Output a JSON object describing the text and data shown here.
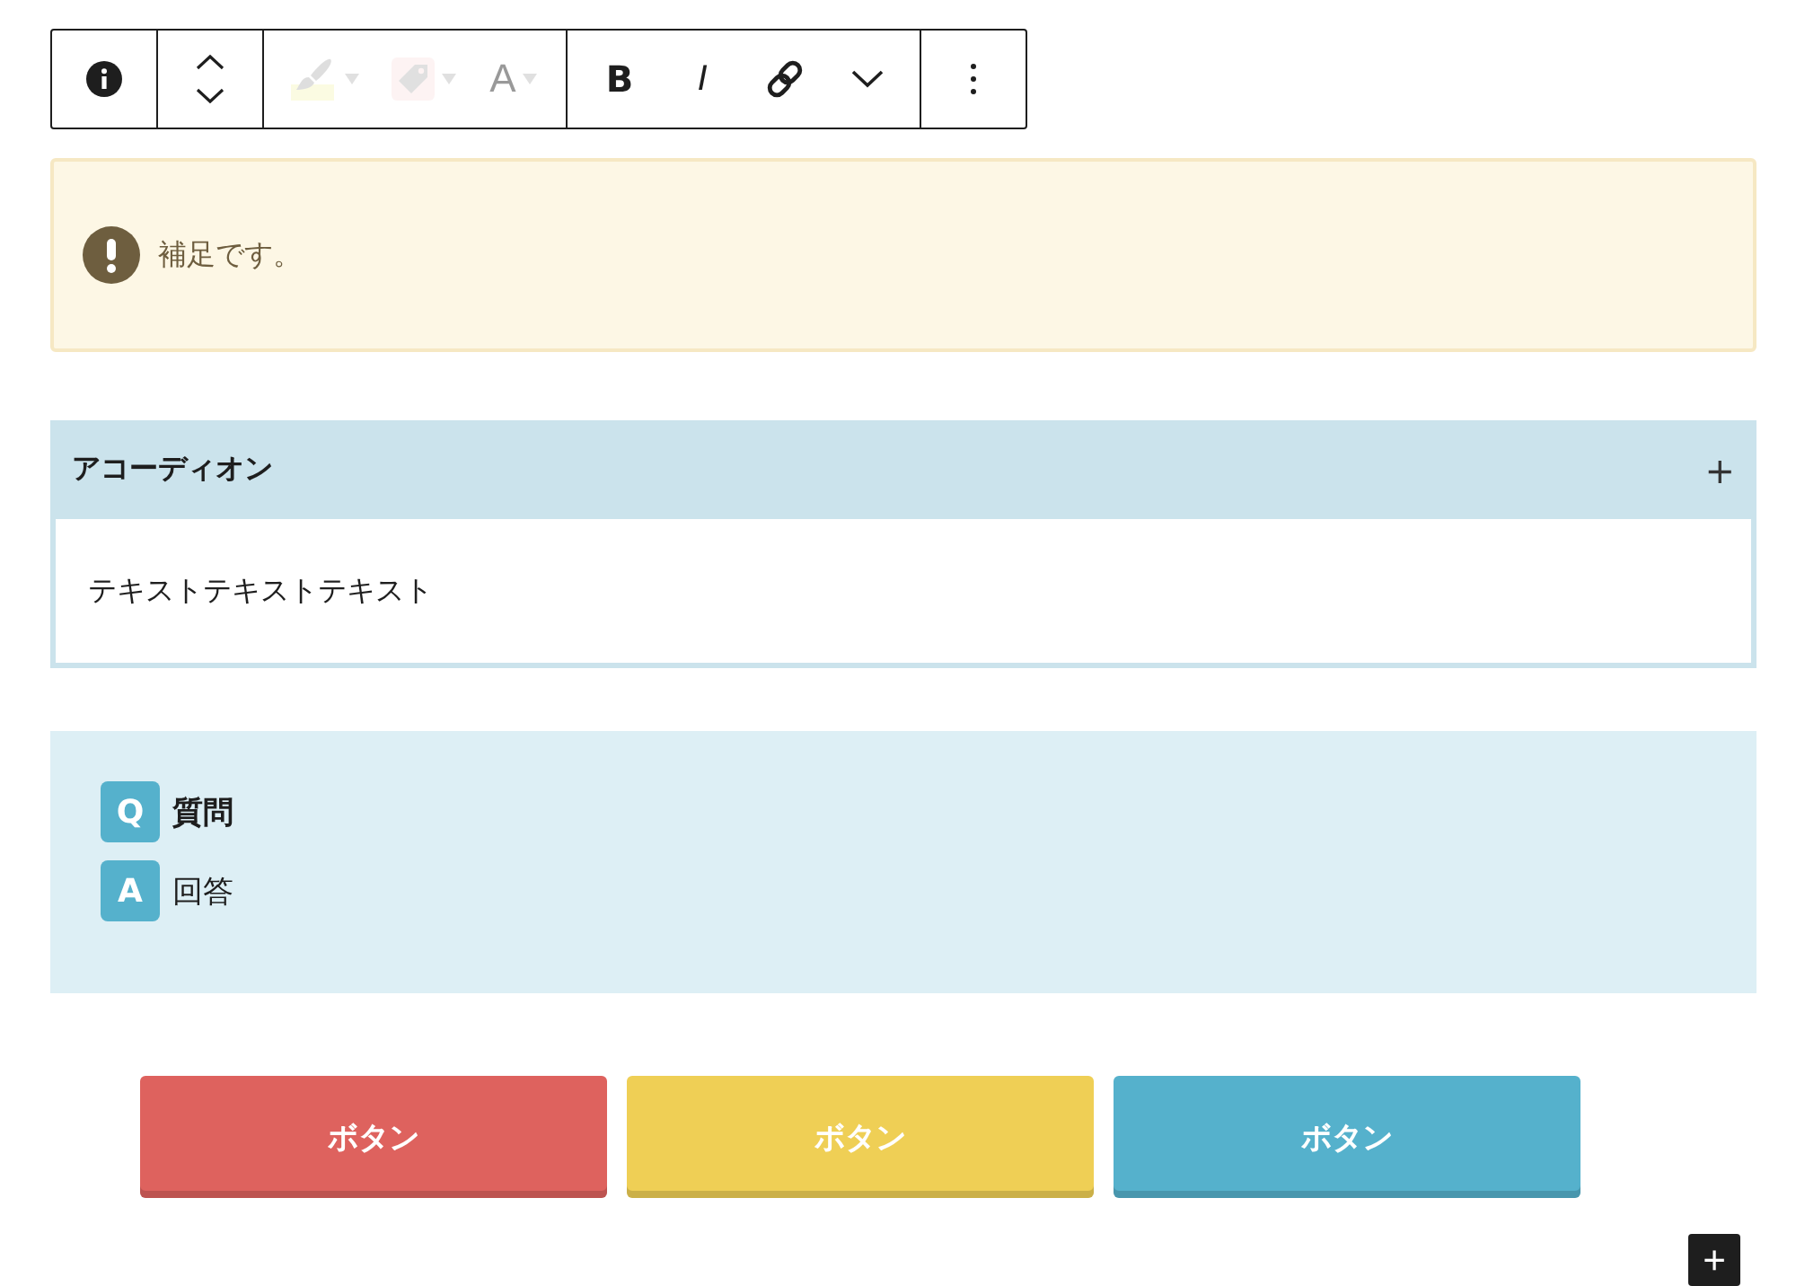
{
  "toolbar": {
    "groups": [
      {
        "items": [
          {
            "kind": "info",
            "disabled": false
          }
        ]
      },
      {
        "items": [
          {
            "kind": "mover",
            "disabled": false
          }
        ]
      },
      {
        "items": [
          {
            "kind": "highlight",
            "disabled": true
          },
          {
            "kind": "badge",
            "disabled": true
          },
          {
            "kind": "textcolor",
            "label": "A",
            "disabled": true
          }
        ]
      },
      {
        "items": [
          {
            "kind": "bold",
            "label": "B",
            "disabled": false
          },
          {
            "kind": "italic",
            "label": "I",
            "disabled": false
          },
          {
            "kind": "link",
            "disabled": false
          },
          {
            "kind": "more",
            "disabled": false
          }
        ]
      },
      {
        "items": [
          {
            "kind": "options",
            "disabled": false
          }
        ]
      }
    ]
  },
  "notice": {
    "text": "補足です。"
  },
  "accordion": {
    "title": "アコーディオン",
    "toggle": "+",
    "expanded": true,
    "body": "テキストテキストテキスト"
  },
  "faq": {
    "question": {
      "mark": "Q",
      "text": "質問"
    },
    "answer": {
      "mark": "A",
      "text": "回答"
    }
  },
  "buttons": [
    {
      "label": "ボタン",
      "color": "#de625e"
    },
    {
      "label": "ボタン",
      "color": "#efcf55"
    },
    {
      "label": "ボタン",
      "color": "#55b1cc"
    }
  ],
  "add_block": {
    "label": "+"
  }
}
